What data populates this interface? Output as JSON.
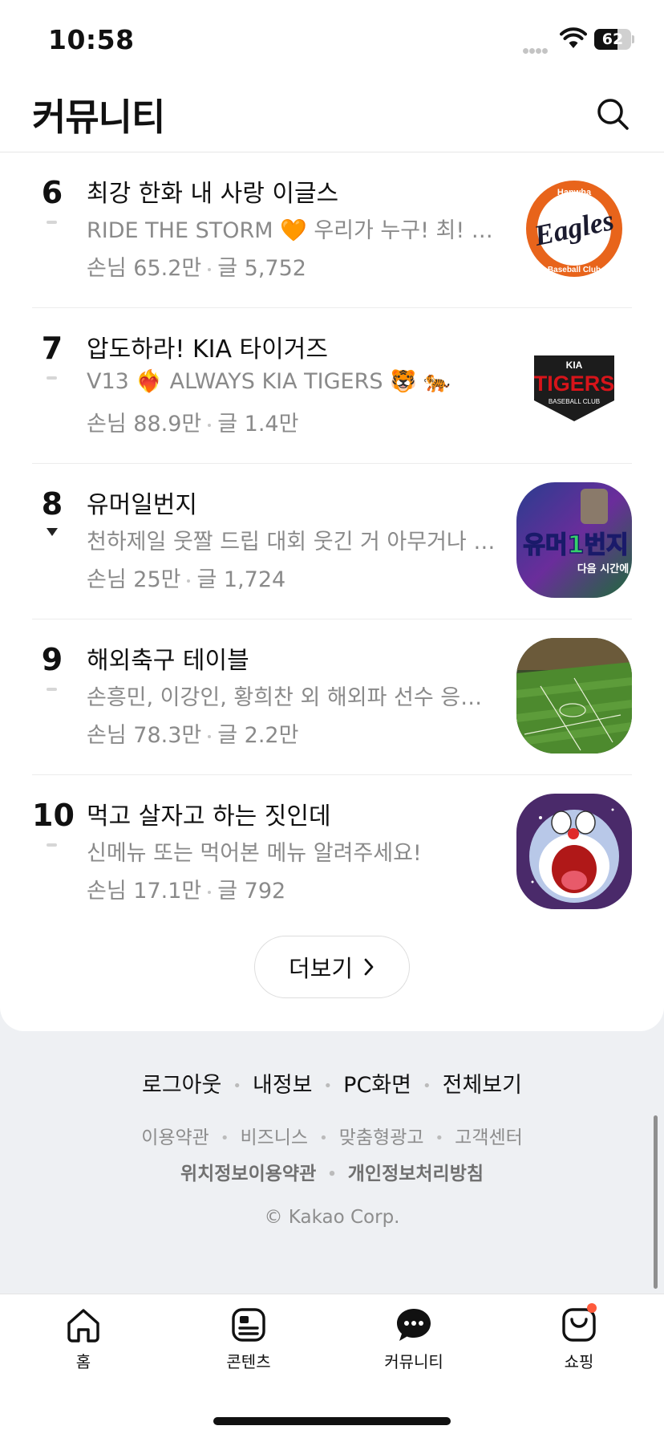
{
  "status_bar": {
    "time": "10:58",
    "battery": "62",
    "battery_level": 0.62
  },
  "header": {
    "title": "커뮤니티"
  },
  "communities": [
    {
      "rank": "6",
      "change": "same",
      "title": "최강 한화 내 사랑 이글스",
      "description": "RIDE THE STORM 🧡 우리가 누구! 최! 강! 한! 화!",
      "visitors": "손님 65.2만",
      "posts": "글 5,752",
      "thumb": "eagles"
    },
    {
      "rank": "7",
      "change": "same",
      "title": "압도하라! KIA 타이거즈",
      "description": "V13 ❤️‍🔥 ALWAYS KIA TIGERS 🐯 🐅",
      "visitors": "손님 88.9만",
      "posts": "글 1.4만",
      "thumb": "tigers"
    },
    {
      "rank": "8",
      "change": "down",
      "title": "유머일번지",
      "description": "천하제일 웃짤 드립 대회 웃긴 거 아무거나 다 올려주세요",
      "visitors": "손님 25만",
      "posts": "글 1,724",
      "thumb": "humor"
    },
    {
      "rank": "9",
      "change": "same",
      "title": "해외축구 테이블",
      "description": "손흥민, 이강인, 황희찬 외 해외파 선수 응원 테이블",
      "visitors": "손님 78.3만",
      "posts": "글 2.2만",
      "thumb": "soccer"
    },
    {
      "rank": "10",
      "change": "same",
      "title": "먹고 살자고 하는 짓인데",
      "description": "신메뉴 또는 먹어본 메뉴 알려주세요!",
      "visitors": "손님 17.1만",
      "posts": "글 792",
      "thumb": "doraemon"
    }
  ],
  "thumb_labels": {
    "eagles_top": "Hanwha",
    "eagles_main": "Eagles",
    "eagles_bottom": "Baseball Club",
    "tigers_brand": "KIA",
    "tigers_main": "TIGERS",
    "tigers_sub": "BASEBALL CLUB",
    "humor_main": "유머1번지",
    "humor_sub": "다음 시간에"
  },
  "more_button": {
    "label": "더보기"
  },
  "footer": {
    "links_primary": [
      "로그아웃",
      "내정보",
      "PC화면",
      "전체보기"
    ],
    "links_secondary": [
      "이용약관",
      "비즈니스",
      "맞춤형광고",
      "고객센터"
    ],
    "links_tertiary": [
      "위치정보이용약관",
      "개인정보처리방침"
    ],
    "copyright": "© Kakao Corp."
  },
  "tabs": [
    {
      "label": "홈",
      "icon": "home-icon"
    },
    {
      "label": "콘텐츠",
      "icon": "content-icon"
    },
    {
      "label": "커뮤니티",
      "icon": "chat-bubble-icon"
    },
    {
      "label": "쇼핑",
      "icon": "shopping-bag-icon",
      "notification": true
    }
  ],
  "colors": {
    "accent_orange": "#e8641b",
    "tigers_red": "#d7141a",
    "notify_dot": "#ff5a3c"
  }
}
